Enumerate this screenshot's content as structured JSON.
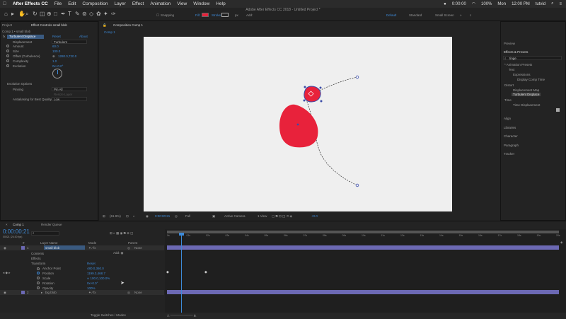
{
  "menubar": {
    "apple": "",
    "app": "After Effects CC",
    "items": [
      "File",
      "Edit",
      "Composition",
      "Layer",
      "Effect",
      "Animation",
      "View",
      "Window",
      "Help"
    ],
    "clock": "0:00:00",
    "battery": "100%",
    "day": "Mon",
    "time": "12:00 PM",
    "user": "tutvid"
  },
  "window": {
    "title": "Adobe After Effects CC 2018 - Untitled Project *"
  },
  "toolbar": {
    "snapping": "Snapping",
    "fill": "Fill:",
    "stroke": "Stroke",
    "px": "px",
    "add": "Add:",
    "workspaces": [
      "Default",
      "Standard",
      "Small Screen"
    ]
  },
  "project": {
    "tab": "Project",
    "effect_tab": "Effect Controls small blob",
    "crumb": "Comp 1 • small blob",
    "effect": {
      "name": "Turbulent Displace",
      "reset": "Reset",
      "about": "About"
    },
    "props": [
      {
        "label": "Displacement",
        "value": "Turbulent"
      },
      {
        "label": "Amount",
        "value": "60.0"
      },
      {
        "label": "Size",
        "value": "100.0"
      },
      {
        "label": "Offset (Turbulence)",
        "value": "1280.0,720.0"
      },
      {
        "label": "Complexity",
        "value": "1.0"
      },
      {
        "label": "Evolution",
        "value": "0x+0.0°"
      },
      {
        "label": "Evolution Options",
        "value": ""
      },
      {
        "label": "Pinning",
        "value": "Pin All"
      },
      {
        "label": "Resize Layer",
        "value": ""
      },
      {
        "label": "Antialiasing for Best Quality",
        "value": "Low"
      }
    ]
  },
  "composition": {
    "tab": "Composition Comp 1",
    "subtab": "Comp 1",
    "zoom": "(61.9%)",
    "time": "0:00:00:21",
    "res": "Full",
    "camera": "Active Camera",
    "views": "1 View",
    "offset": "+0.0"
  },
  "right": {
    "preview": "Preview",
    "effects_presets": "Effects & Presets",
    "search": "tinge",
    "tree": [
      "* Animation Presets",
      "Text",
      "Expressions",
      "Display Comp Time",
      "Distort",
      "Displacement Map",
      "Turbulent Displace",
      "Time",
      "Time Displacement"
    ],
    "panels": [
      "Align",
      "Libraries",
      "Character",
      "Paragraph",
      "Tracker"
    ]
  },
  "timeline": {
    "tab": "Comp 1",
    "render_tab": "Render Queue",
    "timecode": "0:00:00:21",
    "fps": "00021 (24.00 fps)",
    "headers": [
      "#",
      "Layer Name",
      "Mode",
      "T",
      "TrkMat",
      "Parent"
    ],
    "layers": [
      {
        "num": "1",
        "name": "small blob",
        "parent": "None"
      },
      {
        "num": "2",
        "name": "big blob",
        "parent": "None"
      }
    ],
    "props": [
      {
        "label": "Contents",
        "value": "Add: ◉"
      },
      {
        "label": "Effects",
        "value": ""
      },
      {
        "label": "Transform",
        "value": "Reset"
      },
      {
        "label": "Anchor Point",
        "value": "480.0,360.0"
      },
      {
        "label": "Position",
        "value": "1199.3,468.7"
      },
      {
        "label": "Scale",
        "value": "∞ 100.0,100.0%"
      },
      {
        "label": "Rotation",
        "value": "0x+0.0°"
      },
      {
        "label": "Opacity",
        "value": "100%"
      }
    ],
    "ticks": [
      "0s",
      "01s",
      "02s",
      "03s",
      "04s",
      "05s",
      "06s",
      "07s",
      "08s",
      "09s",
      "10s",
      "11s",
      "12s",
      "13s",
      "14s",
      "15s",
      "16s",
      "17s",
      "18s",
      "19s",
      "20s"
    ],
    "footer": "Toggle Switches / Modes"
  },
  "colors": {
    "accent": "#3d8ad8",
    "blob": "#e8223b",
    "timeline_bar": "#6c69b4",
    "playhead": "#3d8ad8"
  }
}
